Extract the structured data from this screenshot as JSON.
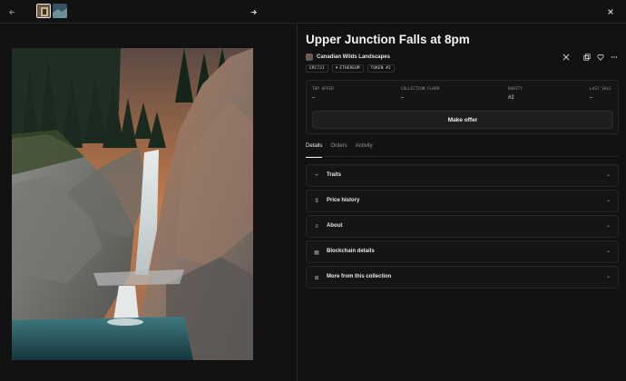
{
  "header": {
    "back_icon": "arrow-left-icon",
    "next_icon": "arrow-right-icon",
    "close_icon": "close-icon",
    "thumbnails": [
      "thumbnail-1",
      "thumbnail-2"
    ]
  },
  "nft": {
    "title": "Upper Junction Falls at 8pm",
    "collection": "Canadian Wilds Landscapes",
    "chips": [
      "ERC721",
      "ETHEREUM",
      "TOKEN #2"
    ],
    "chip_icons": [
      "",
      "diamond-icon",
      ""
    ]
  },
  "stats": [
    {
      "label": "TOP OFFER",
      "value": "–"
    },
    {
      "label": "COLLECTION FLOOR",
      "value": "–"
    },
    {
      "label": "RARITY",
      "value": "#2"
    },
    {
      "label": "LAST SALE",
      "value": "–"
    }
  ],
  "make_offer_label": "Make offer",
  "tabs": [
    "Details",
    "Orders",
    "Activity"
  ],
  "sections": [
    {
      "label": "Traits",
      "icon": "plus-icon",
      "glyph": "+"
    },
    {
      "label": "Price history",
      "icon": "dollar-icon",
      "glyph": "$"
    },
    {
      "label": "About",
      "icon": "text-icon",
      "glyph": "≡"
    },
    {
      "label": "Blockchain details",
      "icon": "grid-icon",
      "glyph": "▦"
    },
    {
      "label": "More from this collection",
      "icon": "tiles-icon",
      "glyph": "⊞"
    }
  ],
  "colors": {
    "background": "#121212",
    "border": "#262626",
    "text": "#e8e8e8",
    "muted": "#8f8f8f"
  }
}
